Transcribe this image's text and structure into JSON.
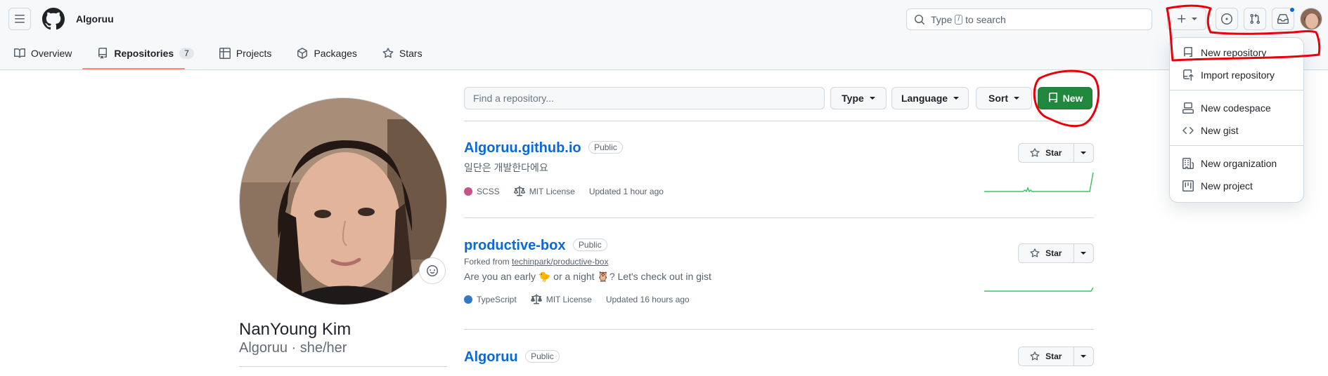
{
  "header": {
    "username": "Algoruu",
    "search_placeholder_before": "Type",
    "search_key": "/",
    "search_placeholder_after": "to search"
  },
  "profile_nav": {
    "tabs": [
      {
        "label": "Overview",
        "icon": "book-icon"
      },
      {
        "label": "Repositories",
        "icon": "repo-icon",
        "count": "7",
        "active": true
      },
      {
        "label": "Projects",
        "icon": "table-icon"
      },
      {
        "label": "Packages",
        "icon": "package-icon"
      },
      {
        "label": "Stars",
        "icon": "star-icon"
      }
    ]
  },
  "profile": {
    "name": "NanYoung Kim",
    "subtitle": "Algoruu · she/her"
  },
  "filters": {
    "search_placeholder": "Find a repository...",
    "type_label": "Type",
    "language_label": "Language",
    "sort_label": "Sort",
    "new_label": "New"
  },
  "repos": [
    {
      "name": "Algoruu.github.io",
      "visibility": "Public",
      "description": "일단은 개발한다에요",
      "language": "SCSS",
      "language_color": "#c6538c",
      "license": "MIT License",
      "updated": "Updated 1 hour ago",
      "star_label": "Star"
    },
    {
      "name": "productive-box",
      "visibility": "Public",
      "forked_prefix": "Forked from",
      "forked_from": "techinpark/productive-box",
      "description": "Are you an early 🐤 or a night 🦉? Let's check out in gist",
      "language": "TypeScript",
      "language_color": "#3178c6",
      "license": "MIT License",
      "updated": "Updated 16 hours ago",
      "star_label": "Star"
    },
    {
      "name": "Algoruu",
      "visibility": "Public",
      "star_label": "Star"
    }
  ],
  "create_menu": {
    "items": [
      {
        "label": "New repository",
        "icon": "repo-icon"
      },
      {
        "label": "Import repository",
        "icon": "repo-push-icon"
      },
      {
        "label": "New codespace",
        "icon": "codespaces-icon"
      },
      {
        "label": "New gist",
        "icon": "code-icon"
      },
      {
        "label": "New organization",
        "icon": "organization-icon"
      },
      {
        "label": "New project",
        "icon": "project-icon"
      }
    ]
  },
  "colors": {
    "accent": "#0969da",
    "primary_button": "#1f883d",
    "active_tab_underline": "#fd8c73",
    "annotation": "#e8000b"
  }
}
